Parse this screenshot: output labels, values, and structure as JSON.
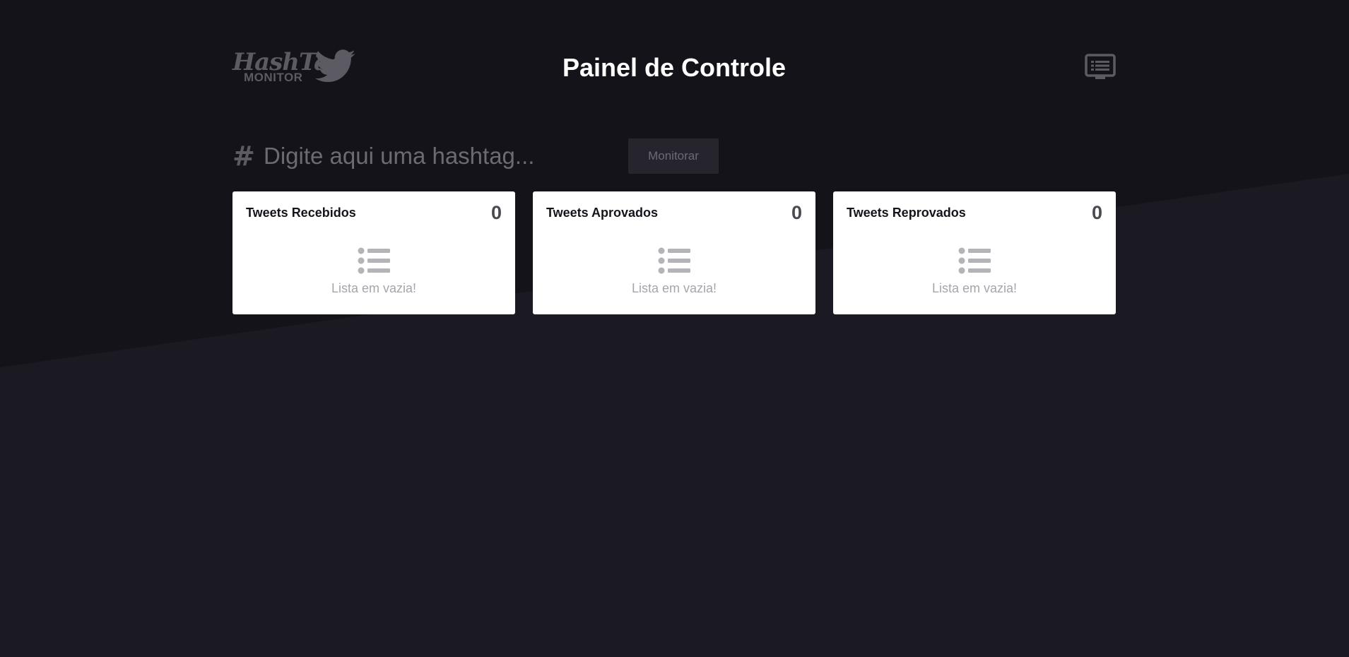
{
  "theme": {
    "background_top": "#14131a",
    "background_bottom": "#1b1a23",
    "card_background": "#ffffff",
    "muted": "#5c5b63"
  },
  "logo": {
    "hashtag_text": "HashTag",
    "monitor_text": "MONITOR",
    "bird_icon": "twitter-bird-icon"
  },
  "header": {
    "title": "Painel de Controle",
    "display_icon": "display-monitor-icon"
  },
  "search": {
    "hash_symbol": "#",
    "placeholder": "Digite aqui uma hashtag...",
    "value": "",
    "button_label": "Monitorar"
  },
  "cards": [
    {
      "title": "Tweets Recebidos",
      "count": "0",
      "empty_icon": "list-icon",
      "empty_text": "Lista em vazia!"
    },
    {
      "title": "Tweets Aprovados",
      "count": "0",
      "empty_icon": "list-icon",
      "empty_text": "Lista em vazia!"
    },
    {
      "title": "Tweets Reprovados",
      "count": "0",
      "empty_icon": "list-icon",
      "empty_text": "Lista em vazia!"
    }
  ]
}
